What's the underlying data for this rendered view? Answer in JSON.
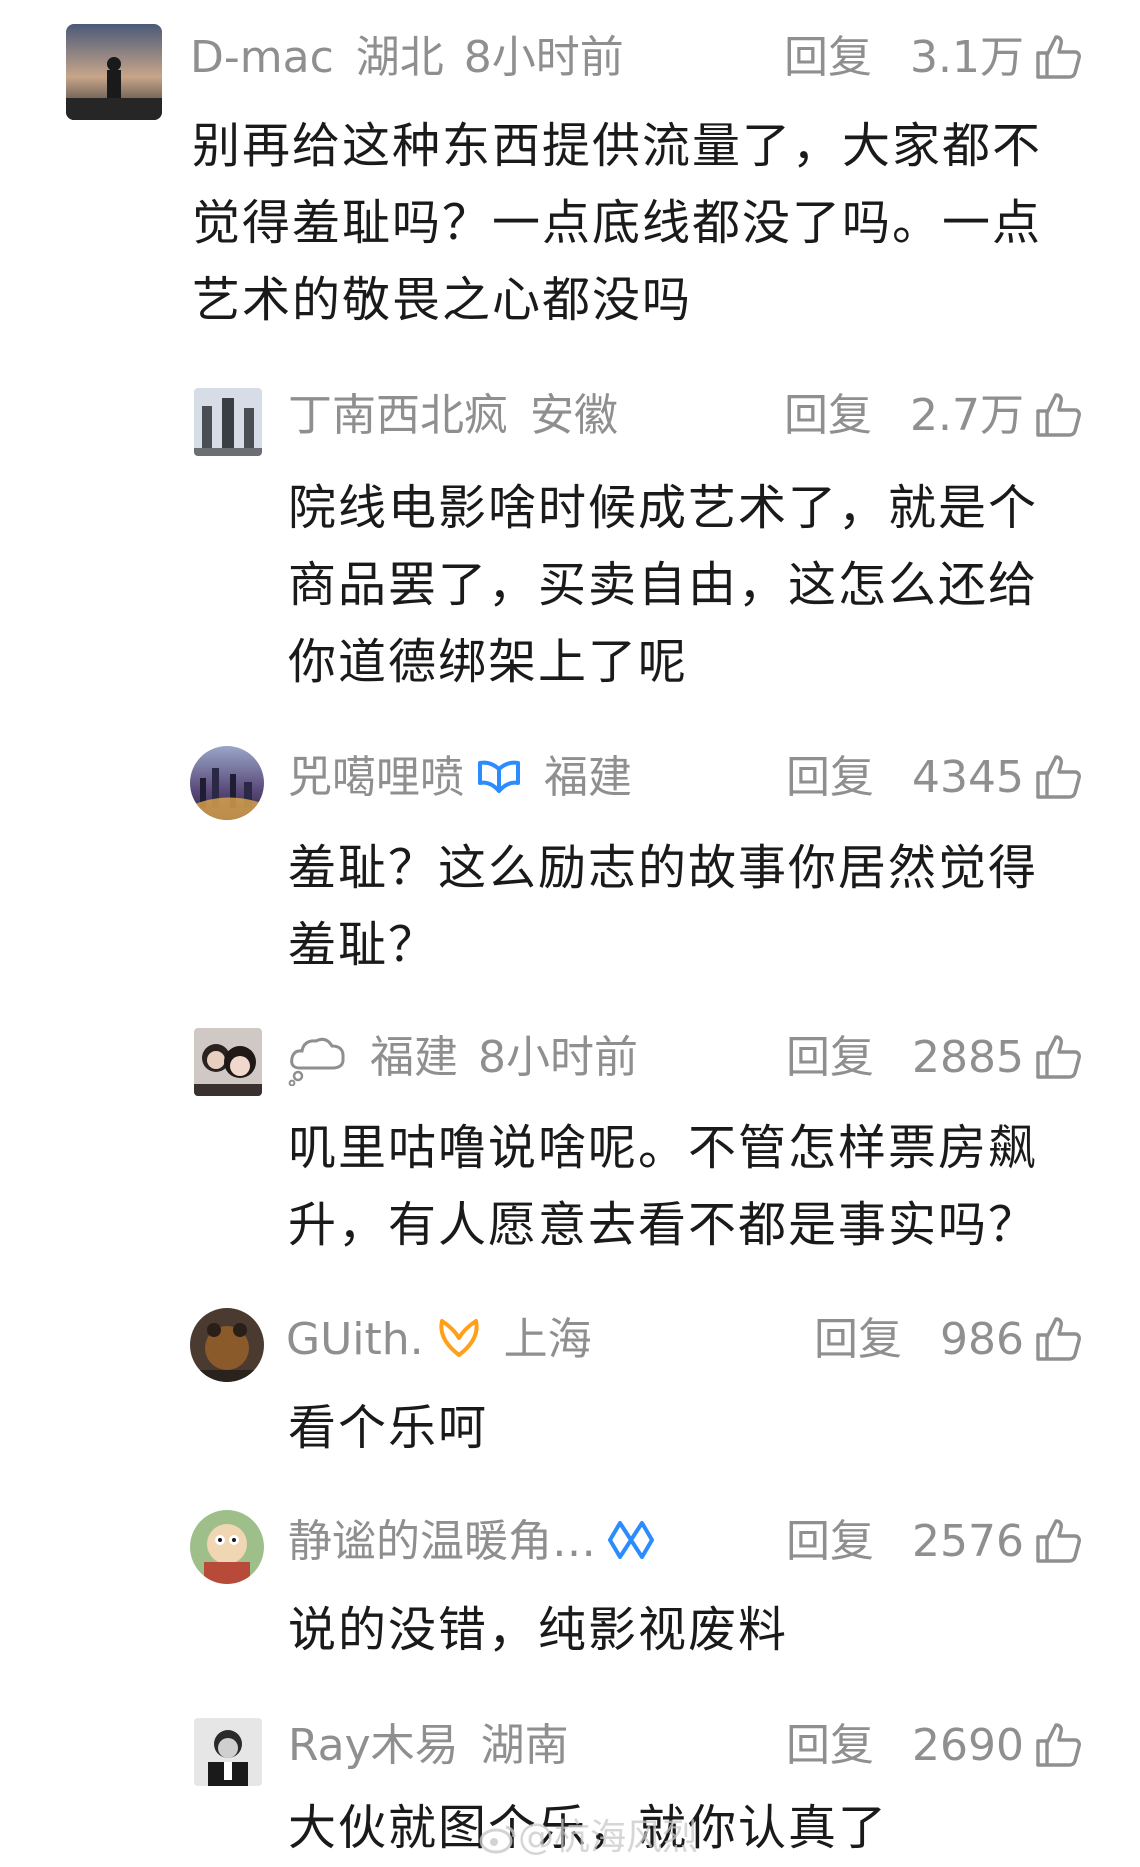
{
  "comments": [
    {
      "name": "D-mac",
      "location": "湖北",
      "time": "8小时前",
      "reply": "回复",
      "likes": "3.1万",
      "text": "别再给这种东西提供流量了，大家都不\n觉得羞耻吗？一点底线都没了吗。一点\n艺术的敬畏之心都没吗"
    },
    {
      "name": "丁南西北疯",
      "location": "安徽",
      "reply": "回复",
      "likes": "2.7万",
      "text": "院线电影啥时候成艺术了，就是个\n商品罢了，买卖自由，这怎么还给\n你道德绑架上了呢"
    },
    {
      "name": "兕噶哩喷",
      "location": "福建",
      "vip": "vip-badge-blue",
      "reply": "回复",
      "likes": "4345",
      "text": "羞耻？这么励志的故事你居然觉得\n羞耻？"
    },
    {
      "name": "",
      "name_icon": "cloud-icon",
      "location": "福建",
      "time": "8小时前",
      "reply": "回复",
      "likes": "2885",
      "text": "叽里咕噜说啥呢。不管怎样票房飙\n升，有人愿意去看不都是事实吗？"
    },
    {
      "name": "GUith.",
      "location": "上海",
      "vip": "vip-badge-orange",
      "reply": "回复",
      "likes": "986",
      "text": "看个乐呵"
    },
    {
      "name": "静谧的温暖角…",
      "vip": "vip-badge-blue-outline",
      "reply": "回复",
      "likes": "2576",
      "text": "说的没错，纯影视废料"
    },
    {
      "name": "Ray木易",
      "location": "湖南",
      "reply": "回复",
      "likes": "2690",
      "text": "大伙就图个乐，就你认真了"
    }
  ],
  "watermark": "@杭海风烈",
  "colors": {
    "meta": "#8f8f8f",
    "text": "#1a1a1a",
    "vip_blue": "#2b8cff",
    "vip_orange": "#ff9f1a"
  }
}
